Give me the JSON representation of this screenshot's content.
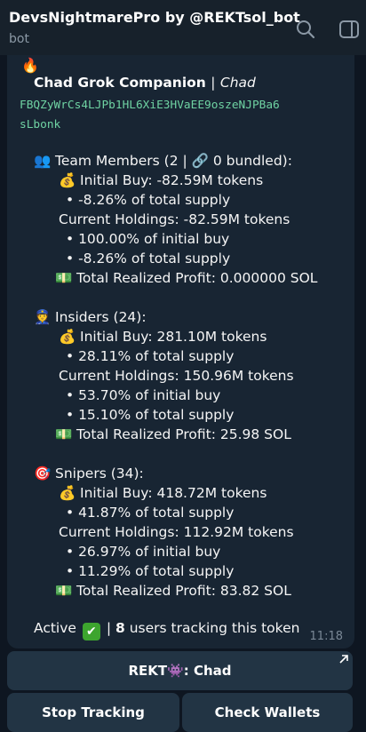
{
  "header": {
    "title": "DevsNightmarePro by @REKTsol_bot",
    "subtitle": "bot"
  },
  "message": {
    "companion_name": "Chad Grok Companion",
    "companion_sep": "|",
    "companion_alias": "Chad",
    "address_line1": "FBQZyWrCs4LJPb1HL6XiE3HVaEE9oszeNJPBa6",
    "address_line2": "sLbonk",
    "team": {
      "heading": "Team Members (2 | 🔗 0 bundled):",
      "initial_buy": "Initial Buy: -82.59M tokens",
      "initial_pct": "• -8.26% of total supply",
      "holdings": "Current Holdings: -82.59M tokens",
      "hold_pct_buy": "• 100.00% of initial buy",
      "hold_pct_supply": "• -8.26% of total supply",
      "profit": "Total Realized Profit: 0.000000 SOL"
    },
    "insiders": {
      "heading": "Insiders (24):",
      "initial_buy": "Initial Buy: 281.10M tokens",
      "initial_pct": "• 28.11% of total supply",
      "holdings": "Current Holdings: 150.96M tokens",
      "hold_pct_buy": "• 53.70% of initial buy",
      "hold_pct_supply": "• 15.10% of total supply",
      "profit": "Total Realized Profit: 25.98 SOL"
    },
    "snipers": {
      "heading": "Snipers (34):",
      "initial_buy": "Initial Buy: 418.72M tokens",
      "initial_pct": "• 41.87% of total supply",
      "holdings": "Current Holdings: 112.92M tokens",
      "hold_pct_buy": "• 26.97% of initial buy",
      "hold_pct_supply": "• 11.29% of total supply",
      "profit": "Total Realized Profit: 83.82 SOL"
    },
    "footer_active": "Active",
    "footer_sep": "|",
    "footer_count": "8",
    "footer_rest": "users tracking this token",
    "time": "11:18"
  },
  "buttons": {
    "rekt": "REKT👾: Chad",
    "stop": "Stop Tracking",
    "check": "Check Wallets"
  },
  "colors": {
    "background": "#0e1621",
    "header": "#17212b",
    "bubble": "#182533",
    "button": "#223444",
    "address": "#6fd3a3"
  }
}
